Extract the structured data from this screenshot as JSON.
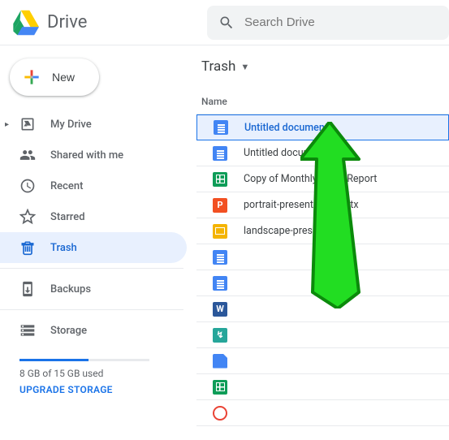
{
  "header": {
    "product": "Drive",
    "search_placeholder": "Search Drive"
  },
  "sidebar": {
    "new_label": "New",
    "items": [
      {
        "label": "My Drive",
        "icon": "my-drive-icon",
        "caret": true
      },
      {
        "label": "Shared with me",
        "icon": "shared-icon"
      },
      {
        "label": "Recent",
        "icon": "recent-icon"
      },
      {
        "label": "Starred",
        "icon": "starred-icon"
      },
      {
        "label": "Trash",
        "icon": "trash-icon",
        "active": true
      }
    ],
    "backups_label": "Backups",
    "storage_label": "Storage",
    "storage_used_text": "8 GB of 15 GB used",
    "storage_fraction": 0.53,
    "upgrade_label": "UPGRADE STORAGE"
  },
  "main": {
    "title": "Trash",
    "column_header": "Name",
    "files": [
      {
        "name": "Untitled document",
        "type": "doc",
        "selected": true
      },
      {
        "name": "Untitled document",
        "type": "doc"
      },
      {
        "name": "Copy of Monthly Sales Report",
        "type": "sheet"
      },
      {
        "name": "portrait-presentation.pptx",
        "type": "pp"
      },
      {
        "name": "landscape-presentation",
        "type": "slides"
      },
      {
        "name": "",
        "type": "doc"
      },
      {
        "name": "",
        "type": "doc"
      },
      {
        "name": "",
        "type": "word"
      },
      {
        "name": "",
        "type": "script"
      },
      {
        "name": "",
        "type": "bluefile"
      },
      {
        "name": "",
        "type": "sheet"
      },
      {
        "name": "",
        "type": "video"
      }
    ]
  }
}
